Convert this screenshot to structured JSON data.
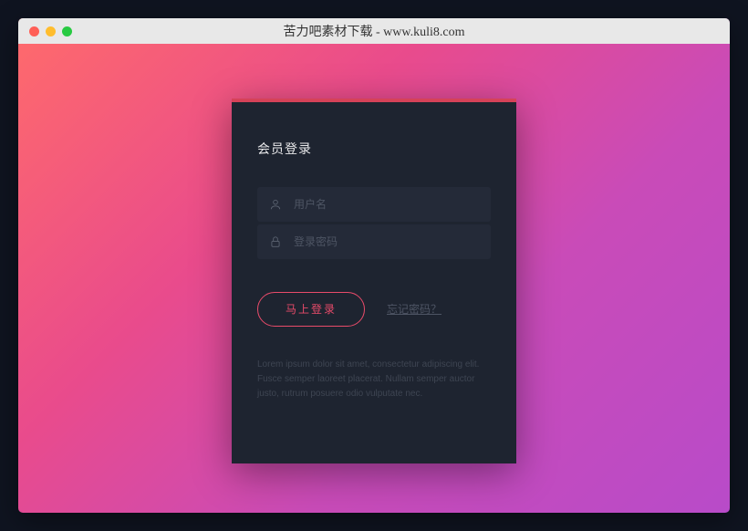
{
  "window": {
    "title": "苦力吧素材下载 - www.kuli8.com"
  },
  "login": {
    "title": "会员登录",
    "username_placeholder": "用户名",
    "password_placeholder": "登录密码",
    "button": "马上登录",
    "forgot": "忘记密码？",
    "footer": "Lorem ipsum dolor sit amet, consectetur adipiscing elit. Fusce semper laoreet placerat. Nullam semper auctor justo, rutrum posuere odio vulputate nec."
  },
  "colors": {
    "accent": "#e94b6a",
    "card_bg": "#1e2430"
  }
}
